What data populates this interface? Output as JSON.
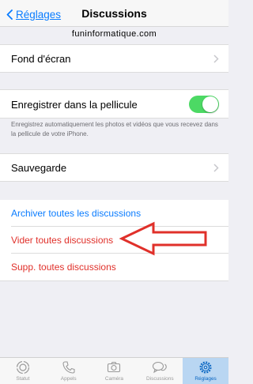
{
  "navbar": {
    "back_label": "Réglages",
    "title": "Discussions"
  },
  "watermark": "funinformatique.com",
  "wallpaper": {
    "label": "Fond d'écran"
  },
  "save_to_roll": {
    "label": "Enregistrer dans la pellicule",
    "enabled": true,
    "footnote": "Enregistrez automatiquement les photos et vidéos que vous recevez dans la pellicule de votre iPhone."
  },
  "backup": {
    "label": "Sauvegarde"
  },
  "actions": {
    "archive_all": "Archiver toutes les discussions",
    "clear_all": "Vider toutes discussions",
    "delete_all": "Supp. toutes discussions"
  },
  "tabs": [
    {
      "label": "Statut",
      "icon": "status-icon"
    },
    {
      "label": "Appels",
      "icon": "phone-icon"
    },
    {
      "label": "Caméra",
      "icon": "camera-icon"
    },
    {
      "label": "Discussions",
      "icon": "chat-bubbles-icon"
    },
    {
      "label": "Réglages",
      "icon": "gear-icon",
      "active": true
    }
  ],
  "colors": {
    "accent_blue": "#0a7cff",
    "destructive_red": "#e0302a",
    "toggle_green": "#4cd964",
    "annotation_arrow": "#e0302a"
  }
}
